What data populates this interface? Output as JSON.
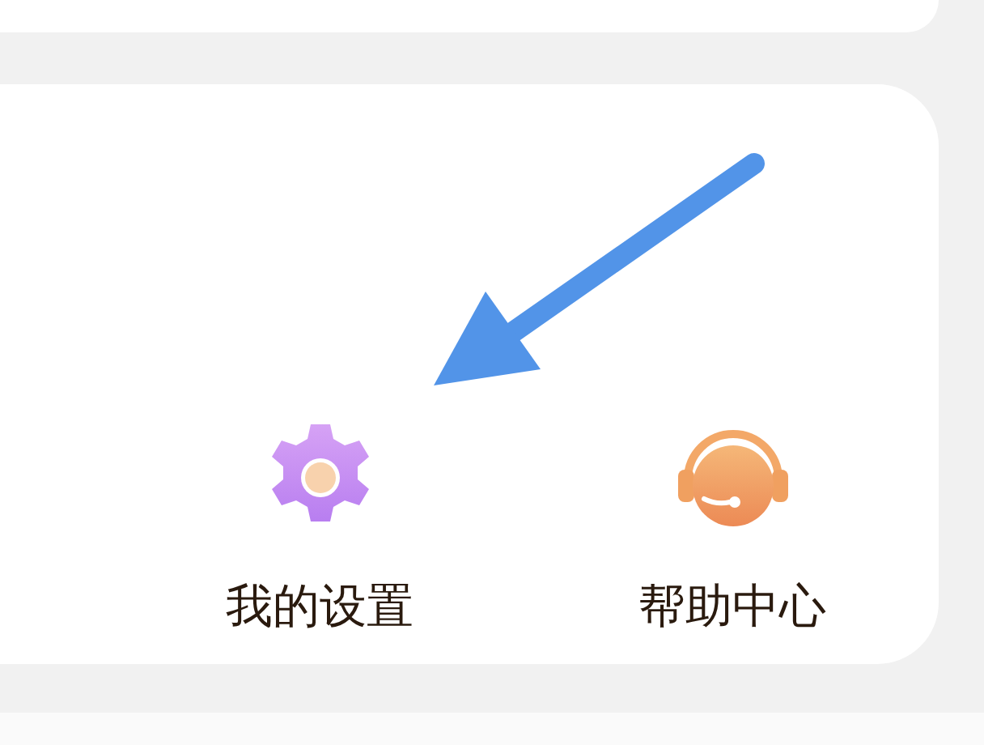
{
  "menu": [
    {
      "label": "我的设置",
      "kind": "settings"
    },
    {
      "label": "帮助中心",
      "kind": "help"
    }
  ]
}
